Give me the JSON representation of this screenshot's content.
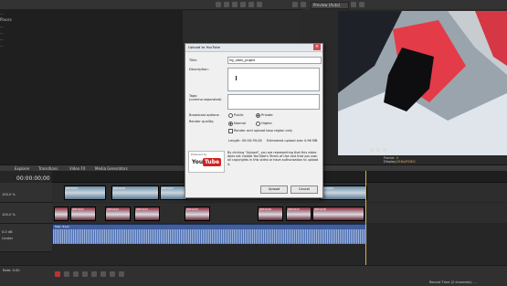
{
  "explorer": {
    "items": [
      "...",
      "Places",
      "...",
      "...",
      "...",
      "...",
      "...",
      "...",
      "...",
      "...",
      "...",
      "..."
    ]
  },
  "preview": {
    "title": "Preview (Auto)",
    "info_frame_label": "Frame:",
    "info_frame_value": "0",
    "info_display_label": "Display:",
    "info_display_value": "256x/ROKG",
    "side_label": "Master B"
  },
  "tabs": [
    "Explorer",
    "Transitions",
    "Video FX",
    "Media Generators"
  ],
  "timeline": {
    "timecode": "00:00:00;00",
    "clip_labels": [
      "JMP1625",
      "JMP1626",
      "JMP1627",
      "JMP1620",
      "JMP1621",
      "JMP1622",
      "JMP1623",
      "JMP1625",
      "JMP1626",
      "JMP1627",
      "JMP1628"
    ],
    "track1_level": "100.0 %",
    "track2_level": "100.0 %",
    "audio_track_name": "Main Track",
    "audio_vol": "0.0 dB",
    "audio_pan": "Center"
  },
  "status": {
    "rate": "Rate: 0.00",
    "record_time": "Record Time (2 channels): ..."
  },
  "dialog": {
    "title": "Upload to YouTube",
    "title_label": "Title:",
    "title_value": "my_video_project",
    "description_label": "Description:",
    "tags_label": "Tags:",
    "tags_hint": "(comma separated)",
    "broadcast_label": "Broadcast options:",
    "broadcast_public": "Public",
    "broadcast_private": "Private",
    "quality_label": "Render quality:",
    "quality_normal": "Normal",
    "quality_higher": "Higher",
    "loop_region_label": "Render and upload loop region only",
    "length_text": "Length: 00:00:39;28",
    "size_text": "Estimated upload size 4.96 MB",
    "logo_powered": "Powered by",
    "logo_you": "You",
    "logo_tube": "Tube",
    "legal_text": "By clicking \"Upload\", you are representing that this video does not violate YouTube's Terms of Use and that you own all copyrights in this video or have authorization to upload it.",
    "upload_button": "Upload",
    "cancel_button": "Cancel"
  }
}
